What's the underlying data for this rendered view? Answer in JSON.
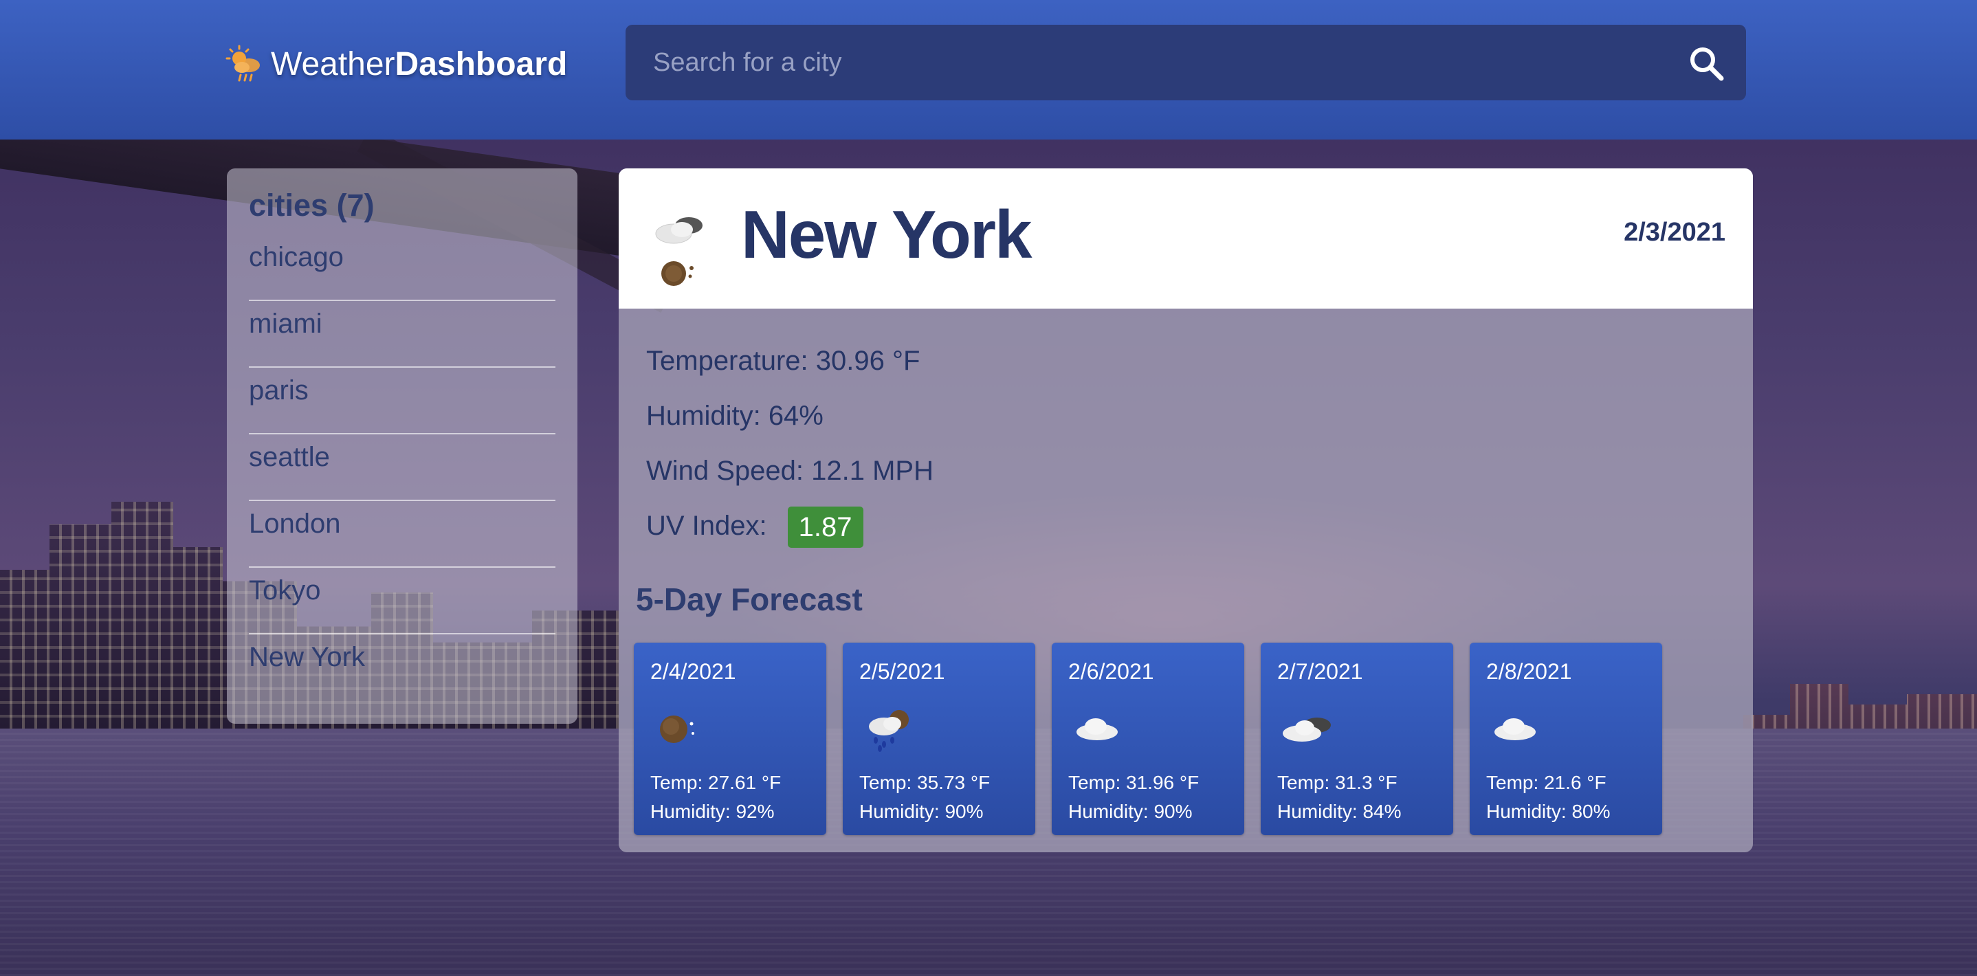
{
  "header": {
    "brand_light": "Weather",
    "brand_bold": "Dashboard",
    "brand_icon": "sun-cloud-rain-icon",
    "search_placeholder": "Search for a city",
    "search_value": "",
    "search_icon": "search-icon"
  },
  "sidebar": {
    "title": "cities (7)",
    "cities": [
      "chicago",
      "miami",
      "paris",
      "seattle",
      "London",
      "Tokyo",
      "New York"
    ]
  },
  "current": {
    "icon": "cloudy-night-icon",
    "city": "New York",
    "date": "2/3/2021",
    "temperature": "Temperature: 30.96 °F",
    "humidity": "Humidity: 64%",
    "wind": "Wind Speed: 12.1 MPH",
    "uv_label": "UV Index:",
    "uv_value": "1.87",
    "uv_color": "#3f8f3a"
  },
  "forecast": {
    "title": "5-Day Forecast",
    "days": [
      {
        "date": "2/4/2021",
        "icon": "clear-night-icon",
        "temp": "Temp: 27.61 °F",
        "humidity": "Humidity: 92%"
      },
      {
        "date": "2/5/2021",
        "icon": "rain-night-icon",
        "temp": "Temp: 35.73 °F",
        "humidity": "Humidity: 90%"
      },
      {
        "date": "2/6/2021",
        "icon": "cloud-icon",
        "temp": "Temp: 31.96 °F",
        "humidity": "Humidity: 90%"
      },
      {
        "date": "2/7/2021",
        "icon": "broken-clouds-icon",
        "temp": "Temp: 31.3 °F",
        "humidity": "Humidity: 84%"
      },
      {
        "date": "2/8/2021",
        "icon": "cloud-icon",
        "temp": "Temp: 21.6 °F",
        "humidity": "Humidity: 80%"
      }
    ]
  },
  "colors": {
    "header_blue": "#3d62c2",
    "text_navy": "#263566",
    "card_blue": "#2a4aa2"
  }
}
